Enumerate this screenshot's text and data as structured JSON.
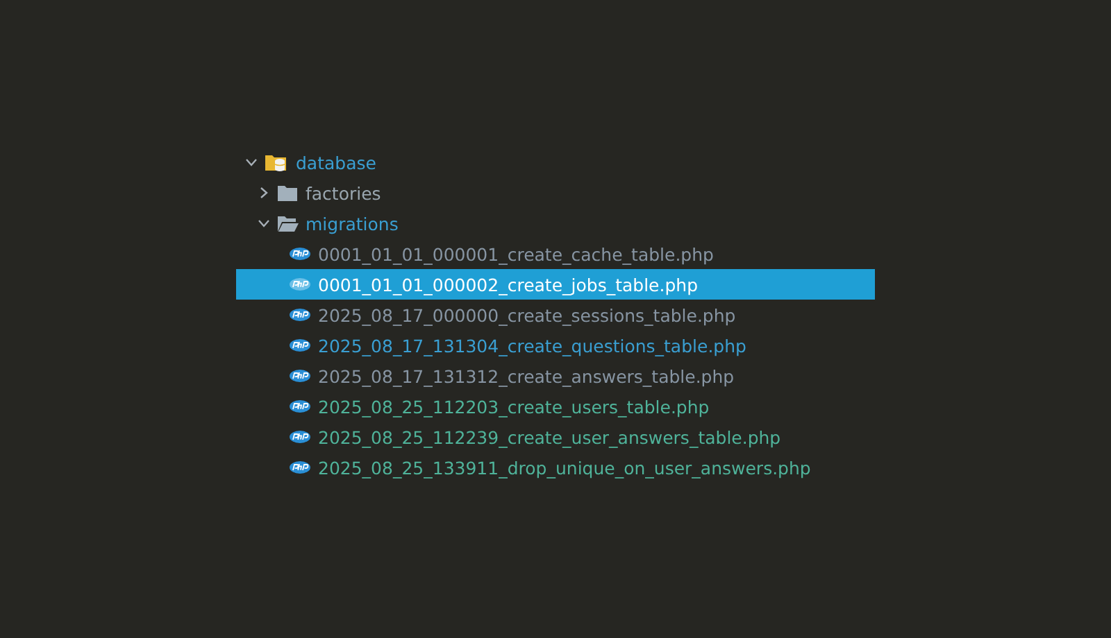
{
  "tree": [
    {
      "name": "database",
      "kind": "db-folder",
      "expanded": true,
      "selected": false,
      "color": "#3a9fd2",
      "children": [
        {
          "name": "factories",
          "kind": "folder",
          "expanded": false,
          "selected": false,
          "color": "#9aa7b0"
        },
        {
          "name": "migrations",
          "kind": "folder",
          "expanded": true,
          "selected": false,
          "color": "#3a9fd2",
          "children": [
            {
              "name": "0001_01_01_000001_create_cache_table.php",
              "kind": "php",
              "selected": false,
              "color": "#8795a3"
            },
            {
              "name": "0001_01_01_000002_create_jobs_table.php",
              "kind": "php",
              "selected": true
            },
            {
              "name": "2025_08_17_000000_create_sessions_table.php",
              "kind": "php",
              "selected": false,
              "color": "#8795a3"
            },
            {
              "name": "2025_08_17_131304_create_questions_table.php",
              "kind": "php",
              "selected": false,
              "color": "#3a9fd2"
            },
            {
              "name": "2025_08_17_131312_create_answers_table.php",
              "kind": "php",
              "selected": false,
              "color": "#8795a3"
            },
            {
              "name": "2025_08_25_112203_create_users_table.php",
              "kind": "php",
              "selected": false,
              "color": "#4fb39a"
            },
            {
              "name": "2025_08_25_112239_create_user_answers_table.php",
              "kind": "php",
              "selected": false,
              "color": "#4fb39a"
            },
            {
              "name": "2025_08_25_133911_drop_unique_on_user_answers.php",
              "kind": "php",
              "selected": false,
              "color": "#4fb39a"
            }
          ]
        }
      ]
    }
  ]
}
